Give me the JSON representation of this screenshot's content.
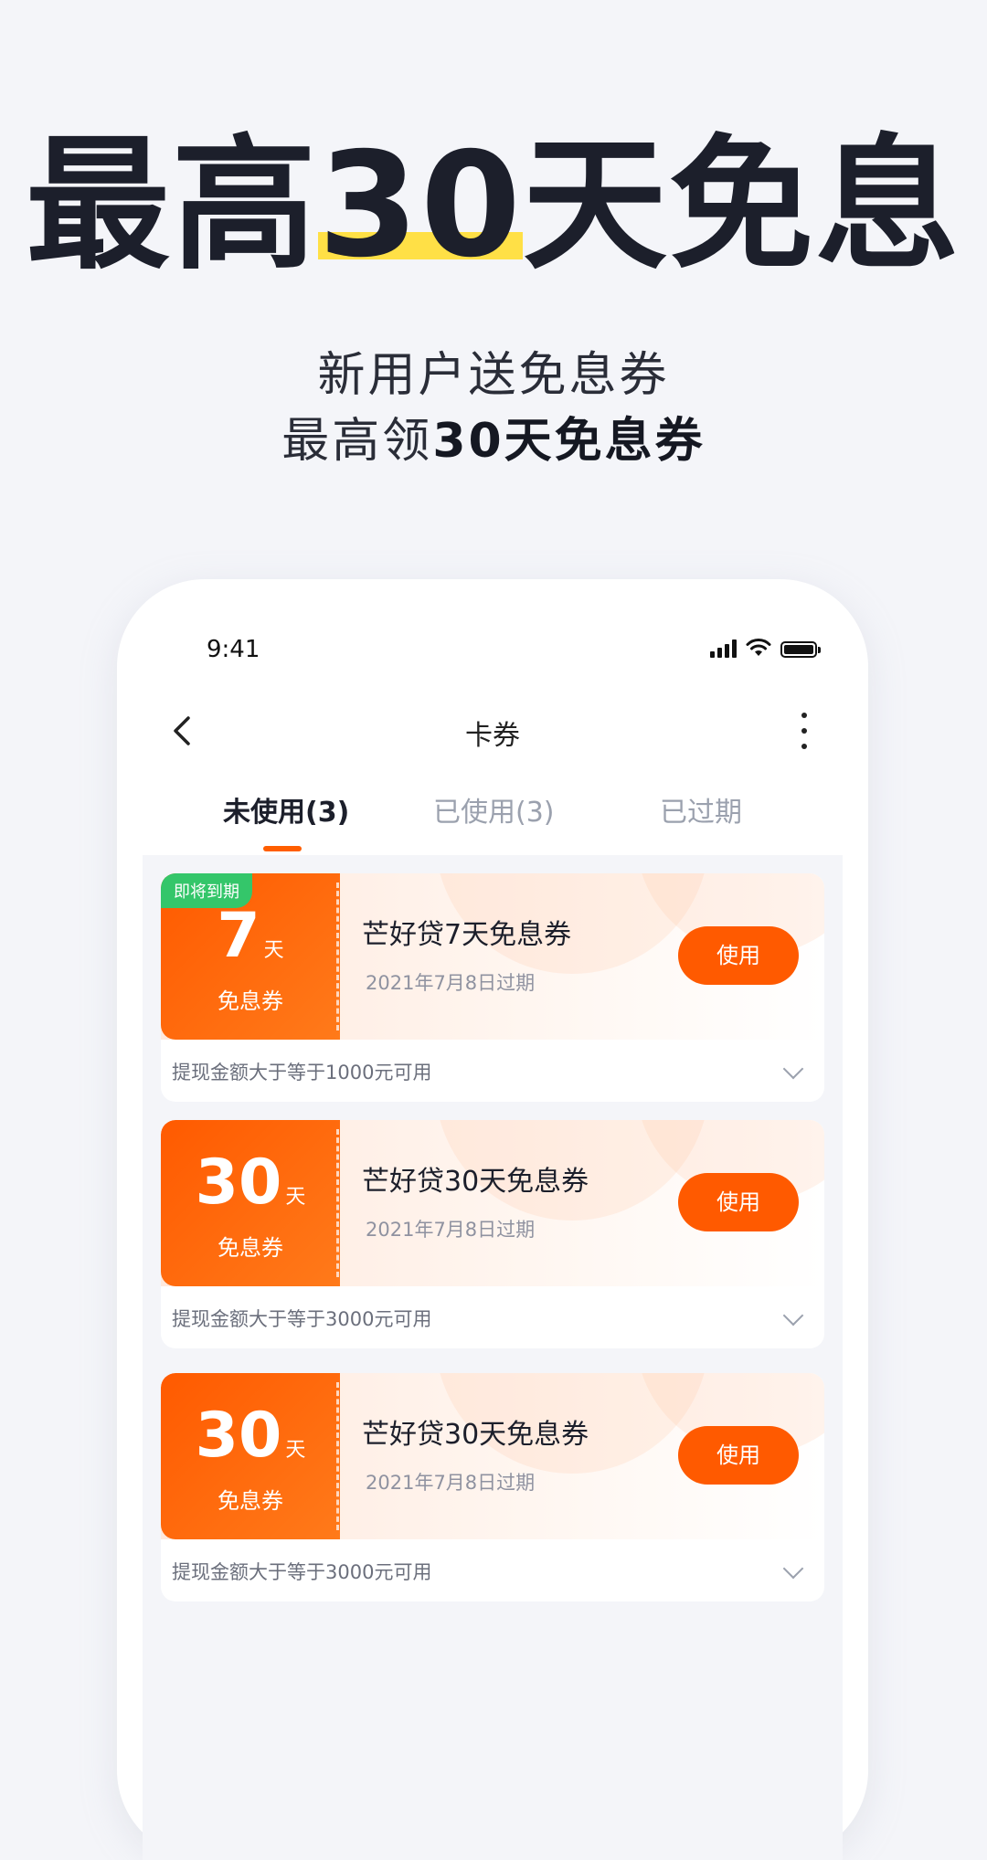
{
  "hero": {
    "title_prefix": "最高",
    "title_highlight": "30",
    "title_suffix": "天免息",
    "subtitle_line1": "新用户送免息券",
    "subtitle_line2_prefix": "最高领",
    "subtitle_line2_bold": "30天免息券"
  },
  "status_bar": {
    "time": "9:41"
  },
  "nav": {
    "title": "卡券"
  },
  "tabs": [
    {
      "label": "未使用(3)"
    },
    {
      "label": "已使用(3)"
    },
    {
      "label": "已过期"
    }
  ],
  "coupons": [
    {
      "badge": "即将到期",
      "amount": "7",
      "unit": "天",
      "tag_label": "免息券",
      "name": "芒好贷7天免息券",
      "expire": "2021年7月8日过期",
      "button": "使用",
      "condition": "提现金额大于等于1000元可用"
    },
    {
      "amount": "30",
      "unit": "天",
      "tag_label": "免息券",
      "name": "芒好贷30天免息券",
      "expire": "2021年7月8日过期",
      "button": "使用",
      "condition": "提现金额大于等于3000元可用"
    },
    {
      "amount": "30",
      "unit": "天",
      "tag_label": "免息券",
      "name": "芒好贷30天免息券",
      "expire": "2021年7月8日过期",
      "button": "使用",
      "condition": "提现金额大于等于3000元可用"
    }
  ],
  "colors": {
    "accent": "#ff5a00",
    "highlight": "#ffe046",
    "badge_green": "#34c66a",
    "background": "#f4f5f9"
  }
}
